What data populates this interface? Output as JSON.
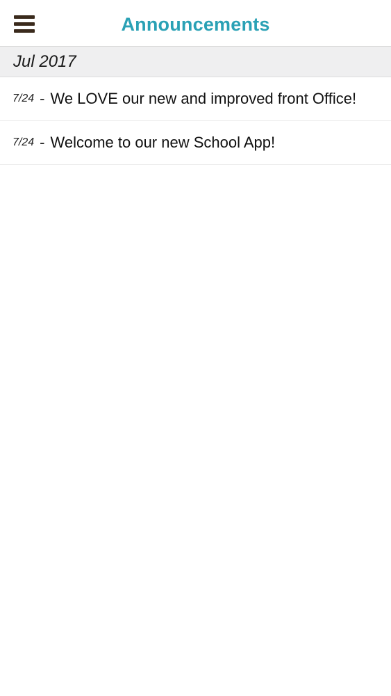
{
  "header": {
    "title": "Announcements",
    "menu_icon": "hamburger-menu-icon"
  },
  "colors": {
    "title": "#2aa1b5",
    "menu_icon": "#3a2a1c",
    "section_bg": "#efeff0"
  },
  "sections": [
    {
      "label": "Jul 2017",
      "items": [
        {
          "date": "7/24",
          "separator": "-",
          "text": "We LOVE our new and improved front Office!"
        },
        {
          "date": "7/24",
          "separator": "-",
          "text": "Welcome to our new School App!"
        }
      ]
    }
  ]
}
